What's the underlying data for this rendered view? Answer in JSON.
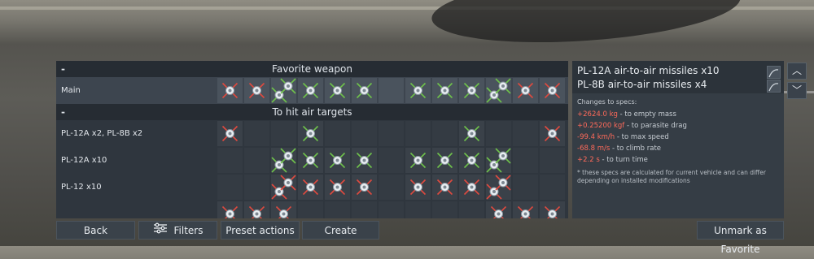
{
  "favorite_section": {
    "dash": "-",
    "title": "Favorite weapon",
    "rows": [
      {
        "label": "Main",
        "slots": [
          "red",
          "red",
          "green2",
          "green",
          "green",
          "green",
          "empty",
          "green",
          "green",
          "green",
          "green2",
          "red",
          "red"
        ]
      }
    ]
  },
  "air_section": {
    "dash": "-",
    "title": "To hit air targets",
    "rows": [
      {
        "label": "PL-12A x2,  PL-8B x2",
        "slots": [
          "red",
          "empty",
          "empty",
          "green",
          "empty",
          "empty",
          "empty",
          "empty",
          "empty",
          "green",
          "empty",
          "empty",
          "red"
        ]
      },
      {
        "label": "PL-12A x10",
        "slots": [
          "empty",
          "empty",
          "green2",
          "green",
          "green",
          "green",
          "empty",
          "green",
          "green",
          "green",
          "green2",
          "empty",
          "empty"
        ]
      },
      {
        "label": "PL-12 x10",
        "slots": [
          "empty",
          "empty",
          "red2",
          "red",
          "red",
          "red",
          "empty",
          "red",
          "red",
          "red",
          "red2",
          "empty",
          "empty"
        ]
      },
      {
        "label": "",
        "slots": [
          "red",
          "red",
          "red",
          "empty",
          "empty",
          "empty",
          "empty",
          "empty",
          "empty",
          "empty",
          "red",
          "red",
          "red"
        ]
      }
    ]
  },
  "selected_loadout": {
    "weapons": [
      {
        "text": "PL-12A air-to-air missiles x10"
      },
      {
        "text": "PL-8B air-to-air missiles x4"
      }
    ],
    "specs_header": "Changes to specs:",
    "specs": [
      {
        "value": "+2624.0 kg",
        "text": " - to empty mass"
      },
      {
        "value": "+0.25200 kgf",
        "text": " - to parasite drag"
      },
      {
        "value": "-99.4 km/h",
        "text": " - to max speed"
      },
      {
        "value": "-68.8 m/s",
        "text": " - to climb rate"
      },
      {
        "value": "+2.2 s",
        "text": " - to turn time"
      }
    ],
    "note": "* these specs are calculated for current vehicle and can differ depending on installed modifications"
  },
  "scroll": {
    "up": "︿",
    "down": "﹀"
  },
  "buttons": {
    "back": "Back",
    "filters": "Filters",
    "preset_actions": "Preset actions",
    "create": "Create",
    "unmark_favorite": "Unmark as Favorite"
  },
  "colors": {
    "panel": "#2f363e",
    "header": "#262c33",
    "accent_red": "#ff6a5a",
    "missile_green": "#6fc24b",
    "missile_red": "#e04a3f"
  }
}
